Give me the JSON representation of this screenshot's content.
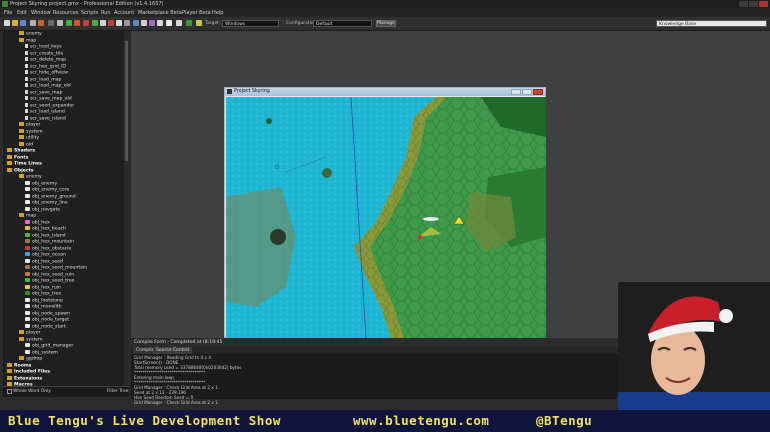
{
  "window": {
    "title": "Project Skyring project.gmx - Professional Edition (v1.4.1657)"
  },
  "menubar": {
    "items": [
      "File",
      "Edit",
      "Window",
      "Resources",
      "Scripts",
      "Run",
      "Account",
      "Marketplace Beta",
      "Player Beta",
      "Help"
    ]
  },
  "toolbar": {
    "target_label": "Target",
    "target_value": "Windows",
    "config_label": "Configuration",
    "config_value": "Default",
    "manage_label": "Manage",
    "kb_label": "Knowledge Base"
  },
  "tree": {
    "rows": [
      {
        "t": "f",
        "d": 2,
        "label": "enemy"
      },
      {
        "t": "f",
        "d": 2,
        "label": "map"
      },
      {
        "t": "d",
        "d": 3,
        "label": "scr_load_keys"
      },
      {
        "t": "d",
        "d": 3,
        "label": "scr_create_tile"
      },
      {
        "t": "d",
        "d": 3,
        "label": "scr_delete_map"
      },
      {
        "t": "d",
        "d": 3,
        "label": "scr_hex_grid_ID"
      },
      {
        "t": "d",
        "d": 3,
        "label": "scr_hide_offview"
      },
      {
        "t": "d",
        "d": 3,
        "label": "scr_load_map"
      },
      {
        "t": "d",
        "d": 3,
        "label": "scr_load_map_old"
      },
      {
        "t": "d",
        "d": 3,
        "label": "scr_save_map"
      },
      {
        "t": "d",
        "d": 3,
        "label": "scr_save_map_old"
      },
      {
        "t": "d",
        "d": 3,
        "label": "scr_seed_expander"
      },
      {
        "t": "d",
        "d": 3,
        "label": "scr_load_island"
      },
      {
        "t": "d",
        "d": 3,
        "label": "scr_save_island"
      },
      {
        "t": "f",
        "d": 2,
        "label": "player"
      },
      {
        "t": "f",
        "d": 2,
        "label": "system"
      },
      {
        "t": "f",
        "d": 2,
        "label": "utility"
      },
      {
        "t": "f",
        "d": 2,
        "label": "old"
      },
      {
        "t": "h",
        "d": 0,
        "label": "Shaders"
      },
      {
        "t": "h",
        "d": 0,
        "label": "Fonts"
      },
      {
        "t": "h",
        "d": 0,
        "label": "Time Lines"
      },
      {
        "t": "h",
        "d": 0,
        "label": "Objects"
      },
      {
        "t": "f",
        "d": 2,
        "label": "enemy"
      },
      {
        "t": "s",
        "d": 3,
        "label": "obj_enemy",
        "c": "#e8e8e8"
      },
      {
        "t": "s",
        "d": 3,
        "label": "obj_enemy_core",
        "c": "#e8e8e8"
      },
      {
        "t": "s",
        "d": 3,
        "label": "obj_enemy_ground",
        "c": "#e8e8e8"
      },
      {
        "t": "s",
        "d": 3,
        "label": "obj_enemy_line",
        "c": "#e8e8e8"
      },
      {
        "t": "s",
        "d": 3,
        "label": "obj_navgate",
        "c": "#e8e8e8"
      },
      {
        "t": "f",
        "d": 2,
        "label": "map"
      },
      {
        "t": "s",
        "d": 3,
        "label": "obj_hex",
        "c": "#e86cc8"
      },
      {
        "t": "s",
        "d": 3,
        "label": "obj_hex_beach",
        "c": "#e0c040"
      },
      {
        "t": "s",
        "d": 3,
        "label": "obj_hex_island",
        "c": "#48b848"
      },
      {
        "t": "s",
        "d": 3,
        "label": "obj_hex_mountain",
        "c": "#a07850"
      },
      {
        "t": "s",
        "d": 3,
        "label": "obj_hex_obstacle",
        "c": "#c04040"
      },
      {
        "t": "s",
        "d": 3,
        "label": "obj_hex_ocean",
        "c": "#40a0e0"
      },
      {
        "t": "s",
        "d": 3,
        "label": "obj_hex_seed",
        "c": "#e8e8e8"
      },
      {
        "t": "s",
        "d": 3,
        "label": "obj_hex_seed_mountain",
        "c": "#a07850"
      },
      {
        "t": "s",
        "d": 3,
        "label": "obj_hex_seed_ruin",
        "c": "#c08040"
      },
      {
        "t": "s",
        "d": 3,
        "label": "obj_hex_seed_tree",
        "c": "#48b848"
      },
      {
        "t": "s",
        "d": 3,
        "label": "obj_hex_ruin",
        "c": "#e0d040"
      },
      {
        "t": "s",
        "d": 3,
        "label": "obj_hex_tree",
        "c": "#2f8f2f"
      },
      {
        "t": "s",
        "d": 3,
        "label": "obj_lootstone",
        "c": "#e8e8e8"
      },
      {
        "t": "s",
        "d": 3,
        "label": "obj_monolith",
        "c": "#e8e8e8"
      },
      {
        "t": "s",
        "d": 3,
        "label": "obj_node_spawn",
        "c": "#e8e8e8"
      },
      {
        "t": "s",
        "d": 3,
        "label": "obj_node_target",
        "c": "#e8e8e8"
      },
      {
        "t": "s",
        "d": 3,
        "label": "obj_node_start",
        "c": "#e8e8e8"
      },
      {
        "t": "f",
        "d": 2,
        "label": "player"
      },
      {
        "t": "f",
        "d": 2,
        "label": "system"
      },
      {
        "t": "s",
        "d": 3,
        "label": "obj_grid_manager",
        "c": "#e8e8e8"
      },
      {
        "t": "s",
        "d": 3,
        "label": "obj_system",
        "c": "#e8e8e8"
      },
      {
        "t": "f",
        "d": 2,
        "label": "ggdrop"
      },
      {
        "t": "h",
        "d": 0,
        "label": "Rooms"
      },
      {
        "t": "h",
        "d": 0,
        "label": "Included Files"
      },
      {
        "t": "h",
        "d": 0,
        "label": "Extensions"
      },
      {
        "t": "h",
        "d": 0,
        "label": "Macros"
      },
      {
        "t": "h",
        "d": 0,
        "label": "Game Information"
      }
    ],
    "footer_left": "Whole Word Only",
    "footer_right": "Filter Tree"
  },
  "game_window": {
    "title": "Project Skyring"
  },
  "console": {
    "title": "Compile Form - Completed at (8:19:45",
    "tabs": [
      "Compile",
      "Source Control"
    ],
    "lines": [
      "Grid Manager : Reading Grid to 4 x 4",
      "StartScreen() - DONE",
      "Total memory used = 33788648(0x02036d2) bytes",
      "**********************************",
      "Entering main loop.",
      "**********************************",
      "Grid Manager : Check Grid Area at 2 x 1",
      "Seed at 2 x 13 - 239.196",
      "Hex Seed Random Seed = 0",
      "Grid Manager : Check Grid Area at 2 x 1"
    ]
  },
  "banner": {
    "show": "Blue Tengu's Live Development Show",
    "url": "www.bluetengu.com",
    "handle": "@BTengu"
  }
}
